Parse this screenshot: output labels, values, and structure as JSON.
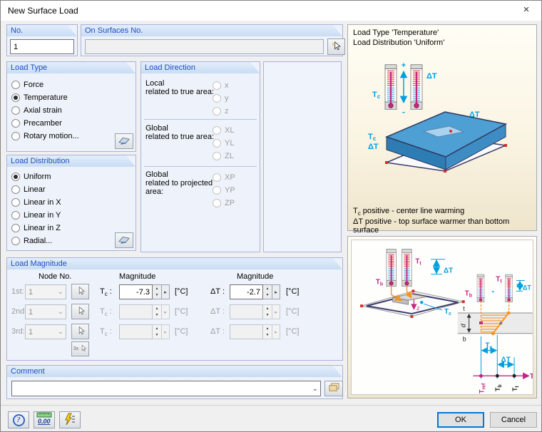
{
  "window": {
    "title": "New Surface Load",
    "close_glyph": "×"
  },
  "no_group": {
    "label": "No.",
    "value": "1"
  },
  "surfaces_group": {
    "label": "On Surfaces No.",
    "value": ""
  },
  "load_type": {
    "label": "Load Type",
    "options": [
      {
        "label": "Force"
      },
      {
        "label": "Temperature"
      },
      {
        "label": "Axial strain"
      },
      {
        "label": "Precamber"
      },
      {
        "label": "Rotary motion..."
      }
    ]
  },
  "load_direction": {
    "label": "Load Direction",
    "local_true": {
      "line1": "Local",
      "line2": "related to true area:",
      "options": [
        "x",
        "y",
        "z"
      ]
    },
    "global_true": {
      "line1": "Global",
      "line2": "related to true area:",
      "options": [
        "XL",
        "YL",
        "ZL"
      ]
    },
    "global_projected": {
      "line1": "Global",
      "line2": "related to projected",
      "line3": "area:",
      "options": [
        "XP",
        "YP",
        "ZP"
      ]
    }
  },
  "load_distribution": {
    "label": "Load Distribution",
    "options": [
      {
        "label": "Uniform"
      },
      {
        "label": "Linear"
      },
      {
        "label": "Linear in X"
      },
      {
        "label": "Linear in Y"
      },
      {
        "label": "Linear in Z"
      },
      {
        "label": "Radial..."
      }
    ]
  },
  "load_magnitude": {
    "label": "Load Magnitude",
    "node_header": "Node No.",
    "magnitude_header1": "Magnitude",
    "magnitude_header2": "Magnitude",
    "t_sym": "T",
    "t_sub": "c",
    "colon": ":",
    "dt_label": "ΔT",
    "picker_3x": "3x",
    "rows": [
      {
        "ordinal": "1st:",
        "node": "1",
        "t_value": "-7.3",
        "dt_value": "-2.7",
        "unit1": "[°C]",
        "unit2": "[°C]"
      },
      {
        "ordinal": "2nd:",
        "node": "1",
        "t_value": "",
        "dt_value": "",
        "unit1": "[°C]",
        "unit2": "[°C]"
      },
      {
        "ordinal": "3rd:",
        "node": "1",
        "t_value": "",
        "dt_value": "",
        "unit1": "[°C]",
        "unit2": "[°C]"
      }
    ]
  },
  "comment_group": {
    "label": "Comment",
    "value": ""
  },
  "footer": {
    "ok": "OK",
    "cancel": "Cancel",
    "units_icon_text": "0,00"
  },
  "colors": {
    "accent_blue": "#1E4FBE",
    "cyan": "#00A0E0",
    "magenta": "#C2267F",
    "orange": "#F7941E",
    "slab_blue": "#4E9FD4"
  },
  "info_top": {
    "title1": "Load Type 'Temperature'",
    "title2": "Load Distribution 'Uniform'",
    "plus": "+",
    "minus": "-",
    "lbl_tc_sym": "T",
    "lbl_tc_sub": "c",
    "lbl_dt": "ΔT",
    "lbl_dt_top": "ΔT",
    "lbl_tc2_sym": "T",
    "lbl_tc2_sub": "c",
    "lbl_dt2": "ΔT",
    "note1_sym": "T",
    "note1_sub": "c",
    "note1_rest": " positive - center line warming",
    "note2": "ΔT positive - top surface warmer than bottom surface"
  },
  "info_bottom": {
    "tb_sym": "T",
    "tb_sub": "b",
    "tt_sym": "T",
    "tt_sub": "t",
    "dt1": "ΔT",
    "tc_sym": "T",
    "tc_sub": "c",
    "z_axis": "z",
    "tb2_sym": "T",
    "tb2_sub": "b",
    "tt2_sym": "T",
    "tt2_sub": "t",
    "minus": "-",
    "dt2": "ΔT",
    "t_top": "t",
    "d_dim": "d",
    "b_bottom": "b",
    "tc2_sym": "T",
    "tc2_sub": "c",
    "dt3": "ΔT",
    "t_axis": "T",
    "tref_sym": "T",
    "tref_sub": "ref",
    "axis_tb_sym": "T",
    "axis_tb_sub": "b",
    "axis_tt_sym": "T",
    "axis_tt_sub": "t"
  }
}
